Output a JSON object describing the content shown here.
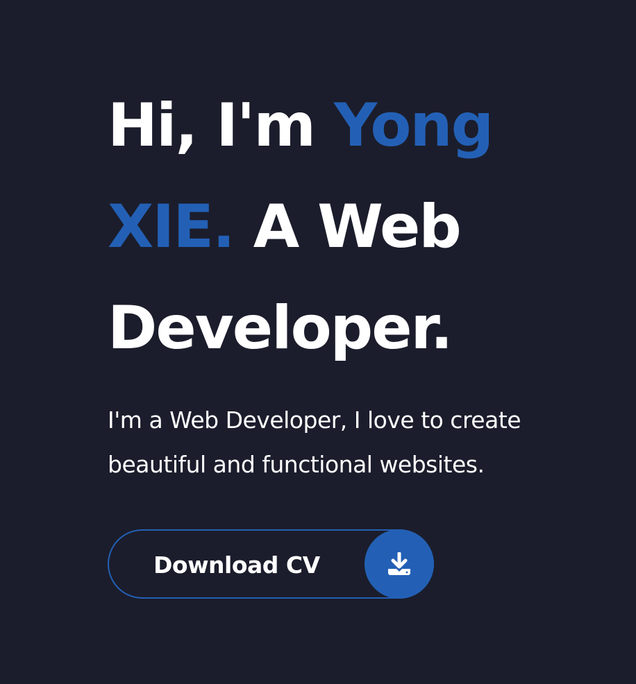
{
  "hero": {
    "greeting": "Hi, I'm",
    "name": "Yong XIE.",
    "role_line": "A Web Developer.",
    "subtitle": "I'm a Web Developer, I love to create beautiful and functional websites."
  },
  "cv_button": {
    "label": "Download CV",
    "icon": "download-icon"
  },
  "colors": {
    "background": "#1b1d2c",
    "accent": "#2360b5",
    "text": "#ffffff"
  }
}
